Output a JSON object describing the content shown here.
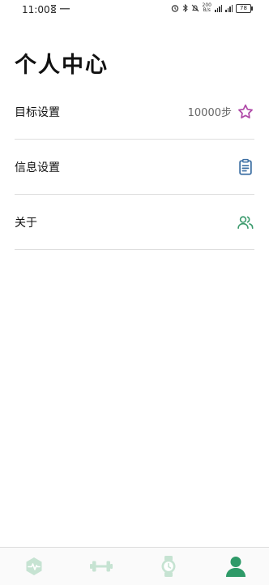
{
  "status_bar": {
    "time": "11:00",
    "net_speed_value": "200",
    "net_speed_unit": "B/s",
    "battery": "78"
  },
  "page": {
    "title": "个人中心"
  },
  "menu": [
    {
      "label": "目标设置",
      "value": "10000步",
      "icon": "star-icon"
    },
    {
      "label": "信息设置",
      "icon": "clipboard-icon"
    },
    {
      "label": "关于",
      "icon": "users-icon"
    }
  ],
  "tabbar": {
    "tabs": [
      {
        "icon": "heart-rate-icon",
        "active": false
      },
      {
        "icon": "dumbbell-icon",
        "active": false
      },
      {
        "icon": "watch-icon",
        "active": false
      },
      {
        "icon": "person-icon",
        "active": true
      }
    ]
  },
  "colors": {
    "star": "#b04aa8",
    "clipboard": "#3d6fa3",
    "users": "#3a9a6c",
    "tab_active": "#2e9a68",
    "tab_inactive": "#c6e3d2"
  }
}
